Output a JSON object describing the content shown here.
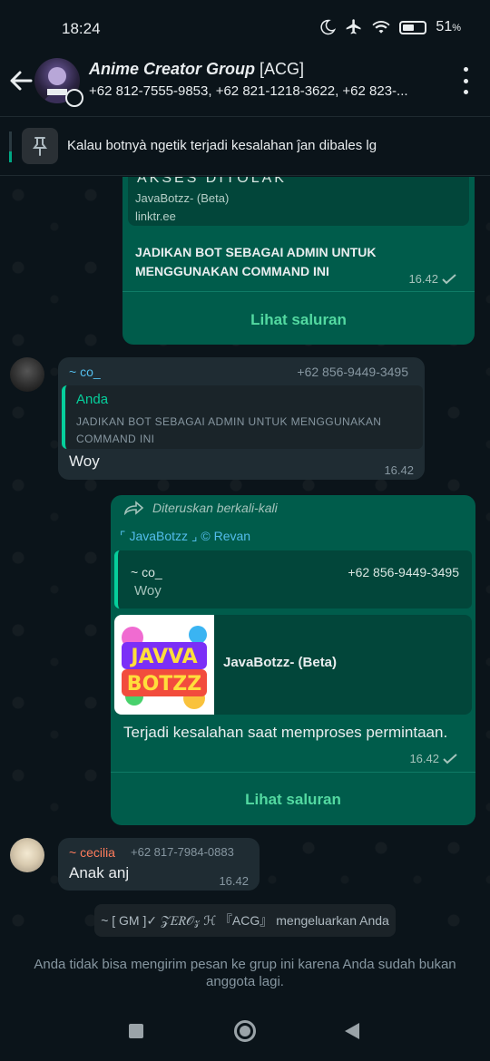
{
  "status_bar": {
    "time": "18:24",
    "battery": "51",
    "battery_unit": "%",
    "battery_level": 0.51
  },
  "header": {
    "title": "Anime Creator Group",
    "title_tag": "[ACG]",
    "participants": "+62 812-7555-9853, +62 821-1218-3622, +62 823-..."
  },
  "pinned": {
    "text": "Kalau botnyà ngetik terjadi kesalahan ĵan dibales lg"
  },
  "messages": {
    "m1": {
      "card_title": "AKSES DITOLAK",
      "card_channel": "JavaBotzz- (Beta)",
      "card_link": "linktr.ee",
      "body_line1": "JADIKAN BOT SEBAGAI ADMIN UNTUK",
      "body_line2": "MENGGUNAKAN COMMAND INI",
      "time": "16.42",
      "action": "Lihat saluran"
    },
    "m2": {
      "sender": "~ co_",
      "phone": "+62 856-9449-3495",
      "quote_author": "Anda",
      "quote_line1": "JADIKAN BOT SEBAGAI ADMIN UNTUK MENGGUNAKAN",
      "quote_line2": "COMMAND INI",
      "text": "Woy",
      "time": "16.42"
    },
    "m3": {
      "forwarded": "Diteruskan berkali-kali",
      "channel_tag": "⌜ JavaBotzz ⌟ © Revan",
      "quote_sender": "~ co_",
      "quote_phone": "+62 856-9449-3495",
      "quote_text": "Woy",
      "preview_logo_line1": "JAVVA",
      "preview_logo_line2": "BOTZZ",
      "preview_title": "JavaBotzz- (Beta)",
      "text": "Terjadi kesalahan saat memproses permintaan.",
      "time": "16.42",
      "action": "Lihat saluran"
    },
    "m4": {
      "sender": "~ cecilia",
      "phone": "+62 817-7984-0883",
      "text": "Anak anj",
      "time": "16.42"
    }
  },
  "system_note": {
    "actor": "~ [ GM ]✓ 𝒵𝐸𝑅𝒪𝓏 ℋ 『ACG』",
    "action": "mengeluarkan Anda"
  },
  "footer": {
    "notice": "Anda tidak bisa mengirim pesan ke grup ini karena Anda sudah bukan anggota lagi."
  },
  "colors": {
    "outgoing": "#005c4b",
    "incoming": "#1f2c33",
    "accent": "#53d9a1",
    "background": "#0b141a"
  }
}
